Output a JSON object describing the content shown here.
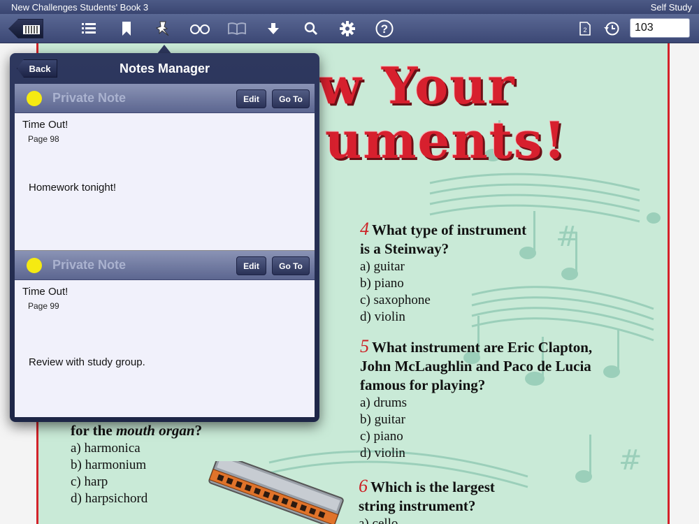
{
  "titlebar": {
    "book_title": "New Challenges Students' Book 3",
    "mode": "Self Study"
  },
  "toolbar": {
    "icons": [
      "library-icon",
      "contents-icon",
      "bookmark-icon",
      "pin-icon",
      "glasses-icon",
      "book-icon",
      "download-icon",
      "search-icon",
      "gear-icon",
      "help-icon",
      "page-icon",
      "history-icon"
    ],
    "page_number": "103"
  },
  "notes_manager": {
    "title": "Notes Manager",
    "back_label": "Back",
    "edit_label": "Edit",
    "goto_label": "Go To",
    "notes": [
      {
        "kind": "Private Note",
        "title": "Time Out!",
        "page": "Page 98",
        "text": "Homework tonight!",
        "color": "#f5ea12"
      },
      {
        "kind": "Private Note",
        "title": "Time Out!",
        "page": "Page 99",
        "text": "Review with study group.",
        "color": "#f5ea12"
      }
    ]
  },
  "book_page": {
    "title_line1": "w Your",
    "title_line2": "uments!",
    "partial_question": {
      "text_before": "for the ",
      "em": "mouth organ",
      "text_after": "?",
      "options": [
        "a) harmonica",
        "b) harmonium",
        "c) harp",
        "d) harpsichord"
      ]
    },
    "questions": [
      {
        "num": "4",
        "lines": [
          "What type of instrument",
          "is a Steinway?"
        ],
        "options": [
          "a) guitar",
          "b) piano",
          "c) saxophone",
          "d) violin"
        ]
      },
      {
        "num": "5",
        "lines": [
          "What instrument are Eric Clapton,",
          "John McLaughlin and Paco de Lucia",
          "famous for playing?"
        ],
        "options": [
          "a) drums",
          "b) guitar",
          "c) piano",
          "d) violin"
        ]
      },
      {
        "num": "6",
        "lines": [
          "Which is the largest",
          "string instrument?"
        ],
        "options": [
          "a) cello"
        ]
      }
    ]
  }
}
